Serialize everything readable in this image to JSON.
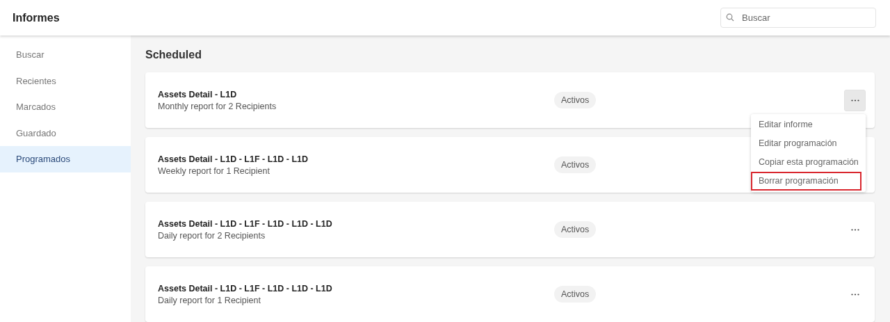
{
  "header": {
    "title": "Informes",
    "search": {
      "placeholder": "Buscar"
    }
  },
  "sidebar": {
    "items": [
      {
        "label": "Buscar",
        "selected": false
      },
      {
        "label": "Recientes",
        "selected": false
      },
      {
        "label": "Marcados",
        "selected": false
      },
      {
        "label": "Guardado",
        "selected": false
      },
      {
        "label": "Programados",
        "selected": true
      }
    ]
  },
  "section_title": "Scheduled",
  "reports": [
    {
      "title": "Assets Detail - L1D",
      "subtitle": "Monthly report for 2 Recipients",
      "status": "Activos",
      "menu_open": true
    },
    {
      "title": "Assets Detail - L1D - L1F - L1D - L1D",
      "subtitle": "Weekly report for 1 Recipient",
      "status": "Activos",
      "menu_open": false
    },
    {
      "title": "Assets Detail - L1D - L1F - L1D - L1D - L1D",
      "subtitle": "Daily report for 2 Recipients",
      "status": "Activos",
      "menu_open": false
    },
    {
      "title": "Assets Detail - L1D - L1F - L1D - L1D - L1D",
      "subtitle": "Daily report for 1 Recipient",
      "status": "Activos",
      "menu_open": false
    }
  ],
  "menu": {
    "items": [
      {
        "label": "Editar informe",
        "highlighted": false
      },
      {
        "label": "Editar programación",
        "highlighted": false
      },
      {
        "label": "Copiar esta programación",
        "highlighted": false
      },
      {
        "label": "Borrar programación",
        "highlighted": true
      }
    ]
  }
}
